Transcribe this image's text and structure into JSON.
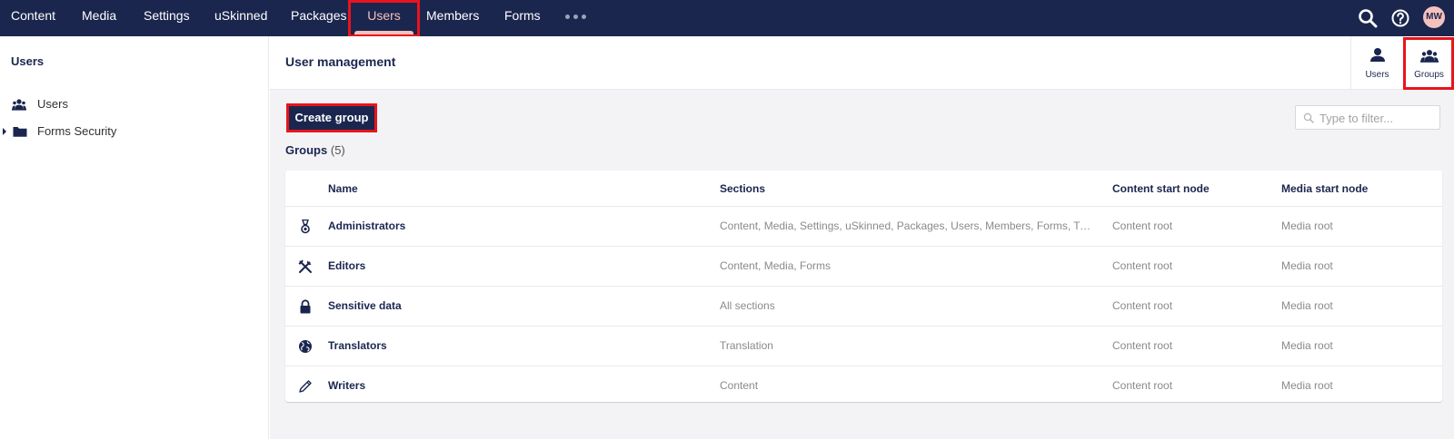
{
  "topnav": {
    "items": [
      {
        "label": "Content"
      },
      {
        "label": "Media"
      },
      {
        "label": "Settings"
      },
      {
        "label": "uSkinned"
      },
      {
        "label": "Packages"
      },
      {
        "label": "Users"
      },
      {
        "label": "Members"
      },
      {
        "label": "Forms"
      }
    ],
    "active_item": "Users",
    "more_icon": "ellipsis-icon",
    "search_icon": "search-icon",
    "help_icon": "help-icon",
    "avatar_initials": "MW"
  },
  "tree": {
    "title": "Users",
    "items": [
      {
        "label": "Users",
        "icon": "users-icon"
      },
      {
        "label": "Forms Security",
        "icon": "folder-icon"
      }
    ]
  },
  "editor": {
    "title": "User management",
    "app_tabs": [
      {
        "label": "Users",
        "icon": "user-icon"
      },
      {
        "label": "Groups",
        "icon": "users-icon"
      }
    ],
    "active_tab": "Groups",
    "create_button": "Create group",
    "filter_placeholder": "Type to filter...",
    "groups_heading": "Groups",
    "groups_count": "(5)"
  },
  "table": {
    "columns": [
      "Name",
      "Sections",
      "Content start node",
      "Media start node"
    ],
    "rows": [
      {
        "icon": "medal-icon",
        "name": "Administrators",
        "sections": "Content, Media, Settings, uSkinned, Packages, Users, Members, Forms, Transl...",
        "content_start": "Content root",
        "media_start": "Media root"
      },
      {
        "icon": "tools-icon",
        "name": "Editors",
        "sections": "Content, Media, Forms",
        "content_start": "Content root",
        "media_start": "Media root"
      },
      {
        "icon": "lock-icon",
        "name": "Sensitive data",
        "sections": "All sections",
        "content_start": "Content root",
        "media_start": "Media root"
      },
      {
        "icon": "globe-icon",
        "name": "Translators",
        "sections": "Translation",
        "content_start": "Content root",
        "media_start": "Media root"
      },
      {
        "icon": "pencil-icon",
        "name": "Writers",
        "sections": "Content",
        "content_start": "Content root",
        "media_start": "Media root"
      }
    ]
  },
  "colors": {
    "brand_navy": "#1b264f",
    "active_pink": "#f5c1bc",
    "highlight_red": "#e8141c",
    "muted_text": "#8a8a8e",
    "body_bg": "#f3f3f5"
  }
}
